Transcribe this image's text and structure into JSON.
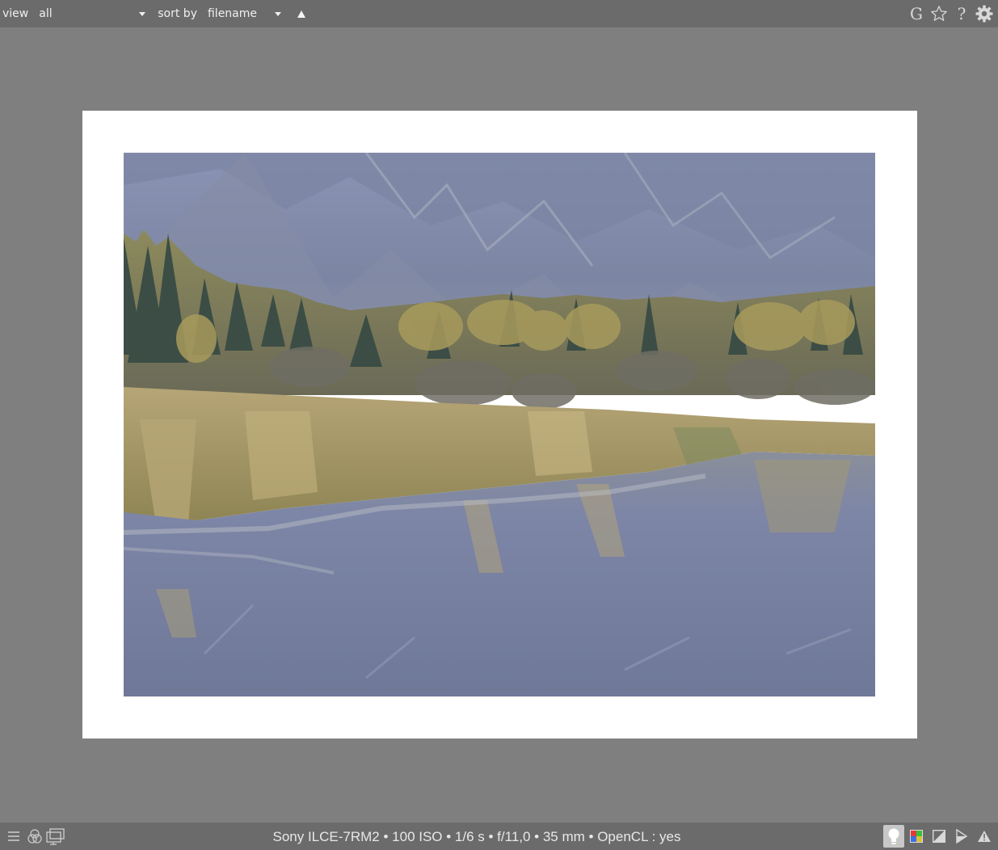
{
  "topbar": {
    "view_label": "view",
    "view_value": "all",
    "sort_label": "sort by",
    "sort_value": "filename",
    "icons": [
      "grouping-icon",
      "star-icon",
      "help-icon",
      "preferences-gear-icon"
    ],
    "grouping_glyph": "G",
    "star_glyph": "☆",
    "help_glyph": "?"
  },
  "image": {
    "frame_color": "#ffffff",
    "background_color": "#7f7f7f"
  },
  "bottombar": {
    "left_icons": [
      "panel-toggle-icon",
      "color-assessment-icon",
      "display-profile-icon"
    ],
    "status_text": "Sony ILCE-7RM2 •  100 ISO • 1/6 s • f/11,0 • 35 mm  • OpenCL : yes",
    "right_icons": [
      "focus-peaking-icon",
      "color-profile-icon",
      "softproof-icon",
      "gamut-check-icon",
      "warning-icon"
    ]
  },
  "colors": {
    "bar": "#6b6b6b",
    "canvas": "#7f7f7f",
    "text": "#e6e6e6"
  }
}
